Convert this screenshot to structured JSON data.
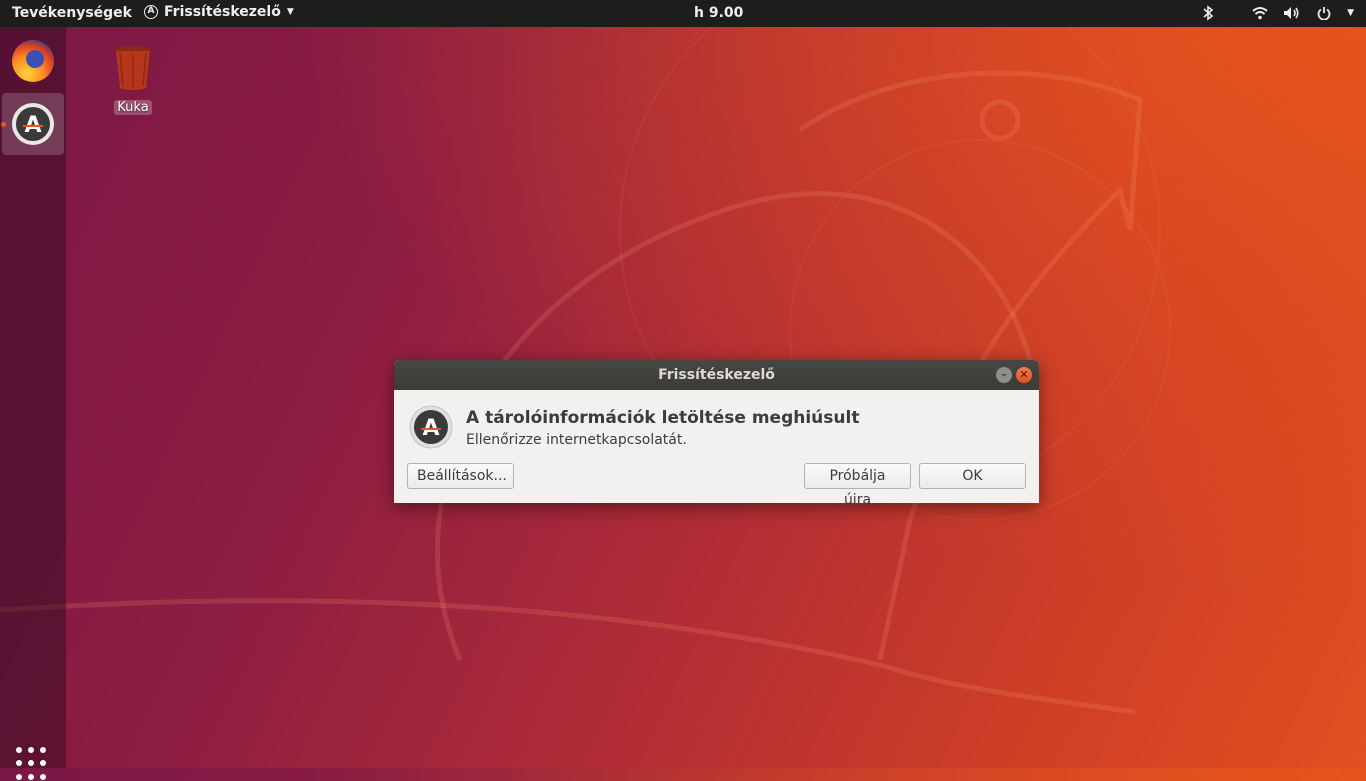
{
  "topbar": {
    "activities": "Tevékenységek",
    "app_menu": "Frissítéskezelő",
    "clock": "h  9.00"
  },
  "dock": {
    "items": [
      {
        "name": "firefox",
        "icon": "firefox-icon"
      },
      {
        "name": "update-manager",
        "icon": "software-updater-icon",
        "active": true
      }
    ]
  },
  "desktop": {
    "icons": [
      {
        "label": "Kuka",
        "icon": "trash-icon"
      }
    ]
  },
  "dialog": {
    "title": "Frissítéskezelő",
    "primary": "A tárolóinformációk letöltése meghiúsult",
    "secondary": "Ellenőrizze internetkapcsolatát.",
    "buttons": {
      "settings": "Beállítások...",
      "retry": "Próbálja újra",
      "ok": "OK"
    }
  },
  "colors": {
    "accent": "#e95420",
    "topbar": "#1d1d1b",
    "titlebar": "#3c3b37"
  }
}
